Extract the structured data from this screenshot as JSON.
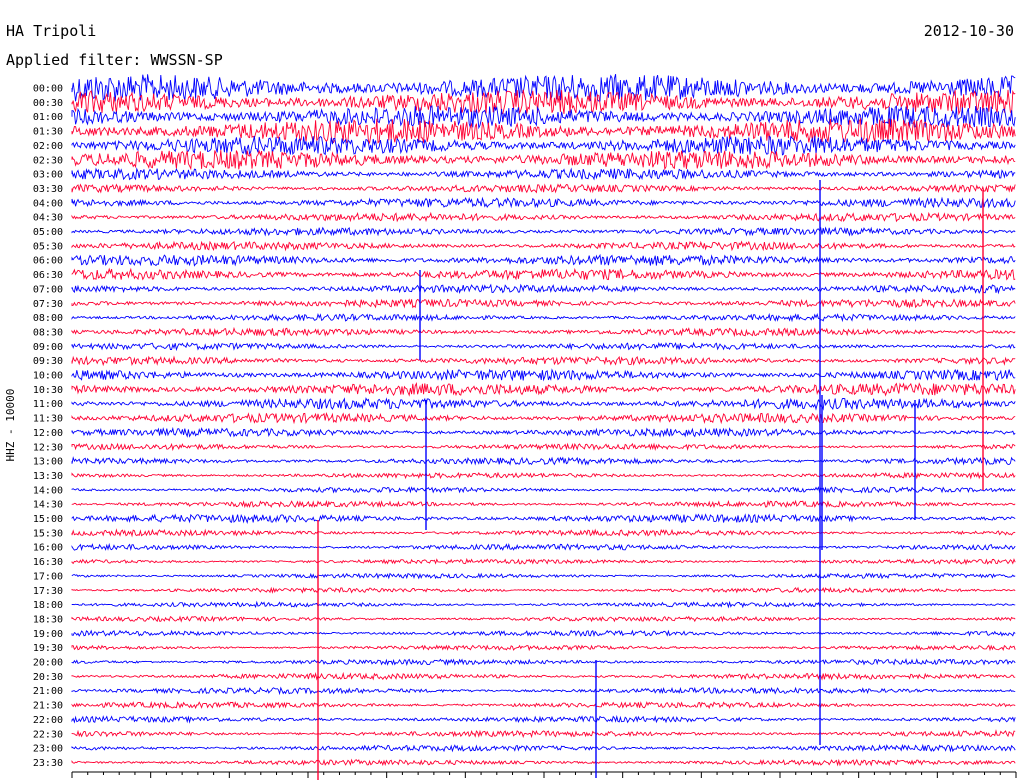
{
  "header": {
    "station": "HA Tripoli",
    "date": "2012-10-30",
    "filter": "Applied filter: WWSSN-SP"
  },
  "chart_data": {
    "type": "line",
    "title": "HA Tripoli",
    "subtitle": "Applied filter: WWSSN-SP",
    "ylabel": "HHZ - 10000",
    "xlabel": "",
    "trace_colors": [
      "#0000ff",
      "#ff0033"
    ],
    "rows": [
      {
        "label": "00:00",
        "noise": 0.9
      },
      {
        "label": "00:30",
        "noise": 0.8
      },
      {
        "label": "01:00",
        "noise": 0.7
      },
      {
        "label": "01:30",
        "noise": 0.8
      },
      {
        "label": "02:00",
        "noise": 0.6
      },
      {
        "label": "02:30",
        "noise": 0.6
      },
      {
        "label": "03:00",
        "noise": 0.3
      },
      {
        "label": "03:30",
        "noise": 0.2
      },
      {
        "label": "04:00",
        "noise": 0.25
      },
      {
        "label": "04:30",
        "noise": 0.2
      },
      {
        "label": "05:00",
        "noise": 0.18
      },
      {
        "label": "05:30",
        "noise": 0.2
      },
      {
        "label": "06:00",
        "noise": 0.3
      },
      {
        "label": "06:30",
        "noise": 0.3
      },
      {
        "label": "07:00",
        "noise": 0.2
      },
      {
        "label": "07:30",
        "noise": 0.2
      },
      {
        "label": "08:00",
        "noise": 0.15
      },
      {
        "label": "08:30",
        "noise": 0.18
      },
      {
        "label": "09:00",
        "noise": 0.15
      },
      {
        "label": "09:30",
        "noise": 0.2
      },
      {
        "label": "10:00",
        "noise": 0.3
      },
      {
        "label": "10:30",
        "noise": 0.35
      },
      {
        "label": "11:00",
        "noise": 0.3
      },
      {
        "label": "11:30",
        "noise": 0.25
      },
      {
        "label": "12:00",
        "noise": 0.2
      },
      {
        "label": "12:30",
        "noise": 0.12
      },
      {
        "label": "13:00",
        "noise": 0.15
      },
      {
        "label": "13:30",
        "noise": 0.1
      },
      {
        "label": "14:00",
        "noise": 0.1
      },
      {
        "label": "14:30",
        "noise": 0.12
      },
      {
        "label": "15:00",
        "noise": 0.2
      },
      {
        "label": "15:30",
        "noise": 0.12
      },
      {
        "label": "16:00",
        "noise": 0.12
      },
      {
        "label": "16:30",
        "noise": 0.08
      },
      {
        "label": "17:00",
        "noise": 0.08
      },
      {
        "label": "17:30",
        "noise": 0.08
      },
      {
        "label": "18:00",
        "noise": 0.08
      },
      {
        "label": "18:30",
        "noise": 0.08
      },
      {
        "label": "19:00",
        "noise": 0.1
      },
      {
        "label": "19:30",
        "noise": 0.08
      },
      {
        "label": "20:00",
        "noise": 0.1
      },
      {
        "label": "20:30",
        "noise": 0.12
      },
      {
        "label": "21:00",
        "noise": 0.12
      },
      {
        "label": "21:30",
        "noise": 0.12
      },
      {
        "label": "22:00",
        "noise": 0.12
      },
      {
        "label": "22:30",
        "noise": 0.12
      },
      {
        "label": "23:00",
        "noise": 0.12
      },
      {
        "label": "23:30",
        "noise": 0.1
      }
    ],
    "grid": false,
    "legend": "none"
  }
}
